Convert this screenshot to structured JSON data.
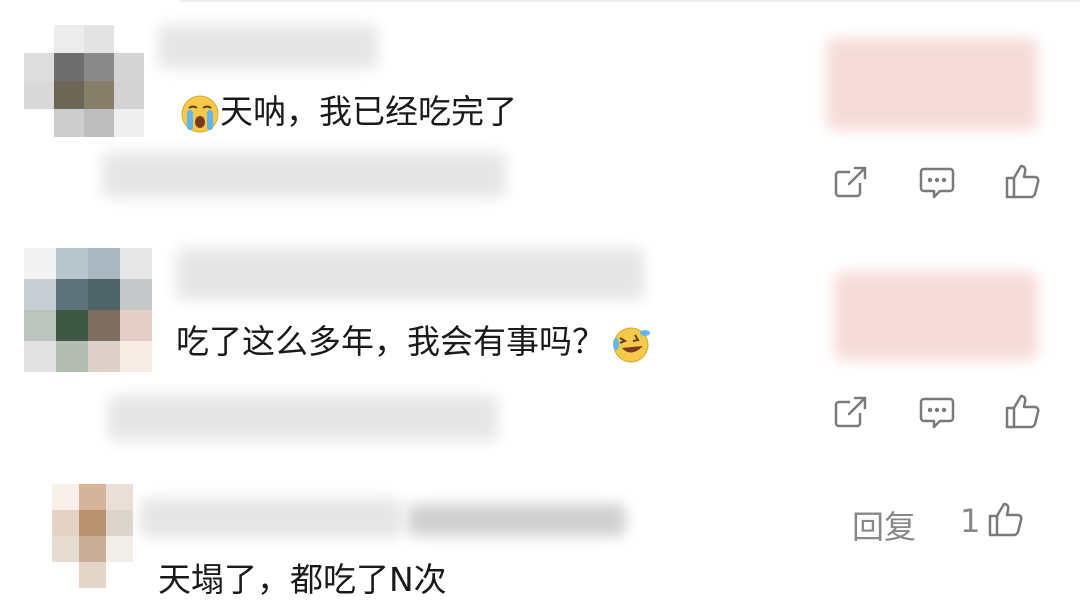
{
  "colors": {
    "text": "#1a1a1a",
    "muted": "#888888",
    "icon": "#7a7a7a",
    "blur_gray": "#e6e6e6",
    "blur_pink": "#f6dcd8"
  },
  "comments": [
    {
      "text": "天呐，我已经吃完了",
      "emoji": "crying-face-icon",
      "avatar_colors": [
        "#ffffff",
        "#ececec",
        "#e3e3e3",
        "#ffffff",
        "#dddddd",
        "#6e6e6e",
        "#8a8a8a",
        "#d5d5d5",
        "#d9d9d9",
        "#6b6656",
        "#867f68",
        "#d2d2d2",
        "#ffffff",
        "#cdcdcd",
        "#bdbdbd",
        "#efefef"
      ],
      "actions": [
        "share-icon",
        "comment-icon",
        "like-icon"
      ]
    },
    {
      "text": "吃了这么多年，我会有事吗？",
      "emoji": "laughing-crying-face-icon",
      "avatar_colors": [
        "#f3f3f3",
        "#b9c5cc",
        "#a9b8c0",
        "#e8e8e8",
        "#c8cfd3",
        "#5e7379",
        "#4f6469",
        "#c5c9c9",
        "#bcc4bf",
        "#3f5845",
        "#7f6e60",
        "#e3cfc7",
        "#e2e2e2",
        "#b3bdb4",
        "#ddd0c8",
        "#f8ece7"
      ],
      "actions": [
        "share-icon",
        "comment-icon",
        "like-icon"
      ]
    },
    {
      "text": "天塌了，都吃了N次",
      "avatar_colors": [
        "#f7f1ea",
        "#d4b59b",
        "#e8dfd6",
        "#e4d3c4",
        "#b99272",
        "#ddd5cd",
        "#e6ddd2",
        "#c9ad96",
        "#f1ede8",
        "#ffffff",
        "#e5d6ca",
        "#ffffff"
      ],
      "reply_label": "回复",
      "like_count": "1"
    }
  ]
}
